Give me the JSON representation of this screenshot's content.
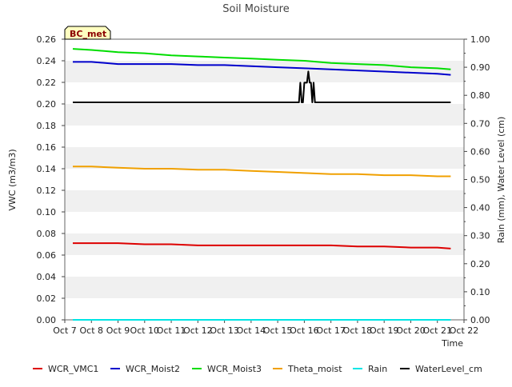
{
  "chart_data": {
    "type": "line",
    "title": "Soil Moisture",
    "xlabel": "Time",
    "ylabel": "VWC (m3/m3)",
    "y2label": "Rain (mm), Water Level (cm)",
    "site_label": "BC_met",
    "x_categories": [
      "Oct 7",
      "Oct 8",
      "Oct 9",
      "Oct 10",
      "Oct 11",
      "Oct 12",
      "Oct 13",
      "Oct 14",
      "Oct 15",
      "Oct 16",
      "Oct 17",
      "Oct 18",
      "Oct 19",
      "Oct 20",
      "Oct 21",
      "Oct 22"
    ],
    "xlim": [
      0,
      15
    ],
    "ylim": [
      0,
      0.26
    ],
    "y_ticks": [
      "0.00",
      "0.02",
      "0.04",
      "0.06",
      "0.08",
      "0.10",
      "0.12",
      "0.14",
      "0.16",
      "0.18",
      "0.20",
      "0.22",
      "0.24",
      "0.26"
    ],
    "y2lim": [
      0,
      1.0
    ],
    "y2_ticks": [
      "0.00",
      "0.10",
      "0.20",
      "0.30",
      "0.40",
      "0.50",
      "0.60",
      "0.70",
      "0.80",
      "0.90",
      "1.00"
    ],
    "grid": "horizontal bands",
    "legend_position": "bottom",
    "series": [
      {
        "name": "WCR_VMC1",
        "color": "#dd0000",
        "axis": "left",
        "x": [
          0.3,
          1.0,
          2.0,
          3.0,
          4.0,
          5.0,
          6.0,
          7.0,
          8.0,
          9.0,
          10.0,
          11.0,
          12.0,
          13.0,
          14.0,
          14.5
        ],
        "y": [
          0.071,
          0.071,
          0.071,
          0.07,
          0.07,
          0.069,
          0.069,
          0.069,
          0.069,
          0.069,
          0.069,
          0.068,
          0.068,
          0.067,
          0.067,
          0.066
        ]
      },
      {
        "name": "WCR_Moist2",
        "color": "#0000cc",
        "axis": "left",
        "x": [
          0.3,
          1.0,
          2.0,
          3.0,
          4.0,
          5.0,
          6.0,
          7.0,
          8.0,
          9.0,
          10.0,
          11.0,
          12.0,
          13.0,
          14.0,
          14.5
        ],
        "y": [
          0.239,
          0.239,
          0.237,
          0.237,
          0.237,
          0.236,
          0.236,
          0.235,
          0.234,
          0.233,
          0.232,
          0.231,
          0.23,
          0.229,
          0.228,
          0.227
        ]
      },
      {
        "name": "WCR_Moist3",
        "color": "#00dd00",
        "axis": "left",
        "x": [
          0.3,
          1.0,
          2.0,
          3.0,
          4.0,
          5.0,
          6.0,
          7.0,
          8.0,
          9.0,
          10.0,
          11.0,
          12.0,
          13.0,
          14.0,
          14.5
        ],
        "y": [
          0.251,
          0.25,
          0.248,
          0.247,
          0.245,
          0.244,
          0.243,
          0.242,
          0.241,
          0.24,
          0.238,
          0.237,
          0.236,
          0.234,
          0.233,
          0.232
        ]
      },
      {
        "name": "Theta_moist",
        "color": "#f0a000",
        "axis": "left",
        "x": [
          0.3,
          1.0,
          2.0,
          3.0,
          4.0,
          5.0,
          6.0,
          7.0,
          8.0,
          9.0,
          10.0,
          11.0,
          12.0,
          13.0,
          14.0,
          14.5
        ],
        "y": [
          0.142,
          0.142,
          0.141,
          0.14,
          0.14,
          0.139,
          0.139,
          0.138,
          0.137,
          0.136,
          0.135,
          0.135,
          0.134,
          0.134,
          0.133,
          0.133
        ]
      },
      {
        "name": "Rain",
        "color": "#00e5e5",
        "axis": "right",
        "x": [
          0.3,
          14.5
        ],
        "y": [
          0.0,
          0.0
        ]
      },
      {
        "name": "WaterLevel_cm",
        "color": "#000000",
        "axis": "right",
        "x": [
          0.3,
          8.8,
          8.85,
          8.9,
          8.95,
          9.0,
          9.1,
          9.15,
          9.2,
          9.25,
          9.3,
          9.35,
          9.4,
          9.45,
          9.5,
          14.5
        ],
        "y": [
          0.775,
          0.775,
          0.845,
          0.775,
          0.775,
          0.845,
          0.845,
          0.885,
          0.845,
          0.845,
          0.775,
          0.845,
          0.775,
          0.775,
          0.775,
          0.775
        ]
      }
    ]
  }
}
